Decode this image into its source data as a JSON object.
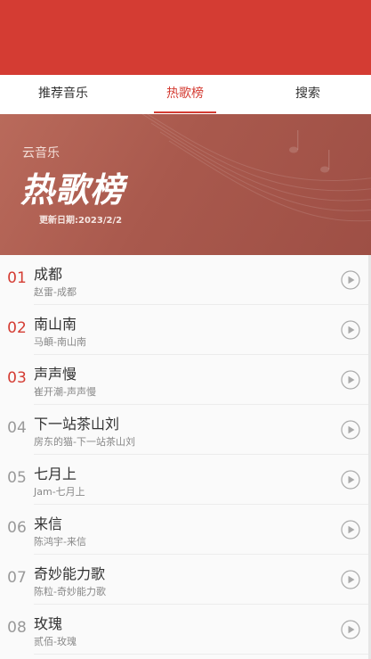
{
  "tabs": [
    {
      "label": "推荐音乐"
    },
    {
      "label": "热歌榜"
    },
    {
      "label": "搜索"
    }
  ],
  "active_tab": "热歌榜",
  "banner": {
    "brand": "云音乐",
    "title": "热歌榜",
    "date_text": "更新日期:2023/2/2"
  },
  "songs": [
    {
      "rank": "01",
      "title": "成都",
      "subtitle": "赵雷-成都"
    },
    {
      "rank": "02",
      "title": "南山南",
      "subtitle": "马頔-南山南"
    },
    {
      "rank": "03",
      "title": "声声慢",
      "subtitle": "崔开潮-声声慢"
    },
    {
      "rank": "04",
      "title": "下一站茶山刘",
      "subtitle": "房东的猫-下一站茶山刘"
    },
    {
      "rank": "05",
      "title": "七月上",
      "subtitle": "Jam-七月上"
    },
    {
      "rank": "06",
      "title": "来信",
      "subtitle": "陈鸿宇-来信"
    },
    {
      "rank": "07",
      "title": "奇妙能力歌",
      "subtitle": "陈粒-奇妙能力歌"
    },
    {
      "rank": "08",
      "title": "玫瑰",
      "subtitle": "贰佰-玫瑰"
    }
  ],
  "colors": {
    "brand_red": "#d43c33",
    "banner": "#a9594d",
    "rank_top": "#d43c33",
    "rank_other": "#999999"
  },
  "icons": {
    "play": "play-circle-icon"
  }
}
